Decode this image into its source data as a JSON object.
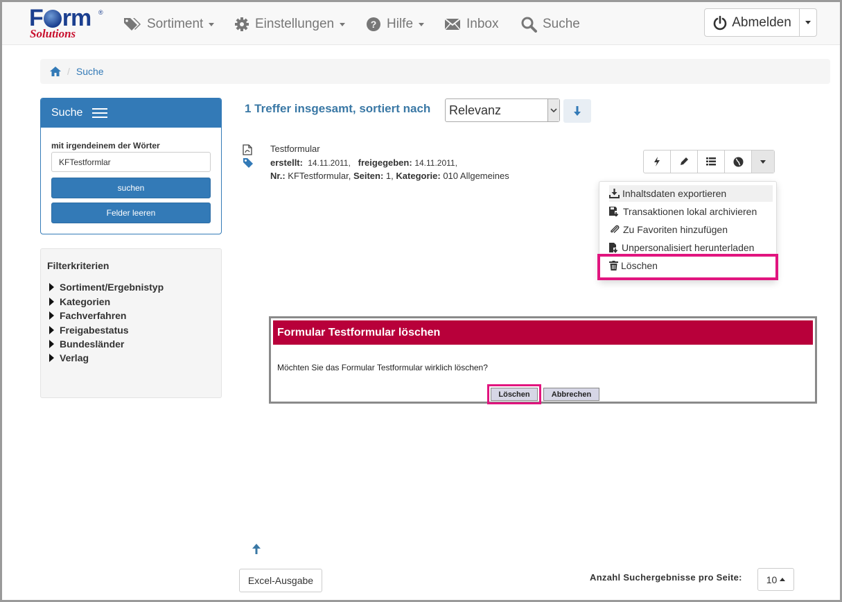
{
  "brand": {
    "logo_word": "Form",
    "logo_sub": "Solutions",
    "reg": "®"
  },
  "nav": {
    "sortiment": "Sortiment",
    "einstellungen": "Einstellungen",
    "hilfe": "Hilfe",
    "inbox": "Inbox",
    "suche": "Suche",
    "logout": "Abmelden"
  },
  "breadcrumb": {
    "current": "Suche"
  },
  "search": {
    "title": "Suche",
    "label": "mit irgendeinem der Wörter",
    "value": "KFTestformlar",
    "submit": "suchen",
    "clear": "Felder leeren"
  },
  "filters": {
    "title": "Filterkriterien",
    "items": [
      "Sortiment/Ergebnistyp",
      "Kategorien",
      "Fachverfahren",
      "Freigabestatus",
      "Bundesländer",
      "Verlag"
    ]
  },
  "results": {
    "summary": "1 Treffer insgesamt, sortiert nach",
    "sort_value": "Relevanz",
    "item": {
      "name": "Testformular",
      "created_label": "erstellt:",
      "created": "14.11.2011,",
      "released_label": "freigegeben:",
      "released": "14.11.2011,",
      "nr_label": "Nr.:",
      "nr": "KFTestformular,",
      "pages_label": "Seiten:",
      "pages": "1,",
      "category_label": "Kategorie:",
      "category": "010 Allgemeines"
    }
  },
  "menu": {
    "export": "Inhaltsdaten exportieren",
    "archive": "Transaktionen lokal archivieren",
    "favorite": "Zu Favoriten hinzufügen",
    "download": "Unpersonalisiert herunterladen",
    "delete": "Löschen"
  },
  "dialog": {
    "title": "Formular Testformular löschen",
    "message": "Möchten Sie das Formular Testformular wirklich löschen?",
    "confirm": "Löschen",
    "cancel": "Abbrechen"
  },
  "footer": {
    "excel": "Excel-Ausgabe",
    "per_page_label": "Anzahl Suchergebnisse pro Seite:",
    "per_page_value": "10"
  },
  "colors": {
    "primary": "#337ab7",
    "dialog_header": "#b8003a",
    "highlight": "#e1157f"
  }
}
